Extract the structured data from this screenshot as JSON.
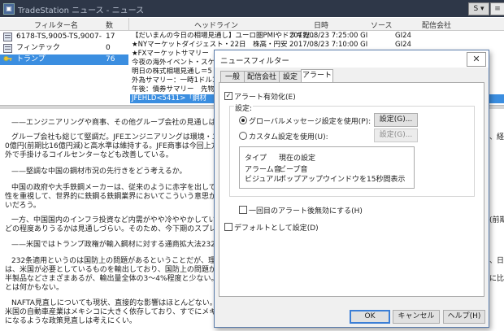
{
  "window": {
    "title": "TradeStation ニュース - ニュース",
    "s_menu": "S ▾",
    "win_btn": "≡"
  },
  "left": {
    "headers": {
      "filter": "フィルター名",
      "count": "数"
    },
    "rows": [
      {
        "name": "6178-TS,9005-TS,9007-",
        "count": "17"
      },
      {
        "name": "フィンテック",
        "count": "0"
      },
      {
        "name": "",
        "count": ""
      },
      {
        "name": "トランプ",
        "count": "76"
      }
    ]
  },
  "grid": {
    "headers": {
      "headline": "ヘッドライン",
      "date": "日時",
      "source": "ソース",
      "provider": "配信会社"
    },
    "rows": [
      {
        "headline": "【だいまんの今日の相場見通し】ユーロ圏PMIやドラギ総...",
        "date": "2017/08/23 7:25:00 GI",
        "source": "GI24"
      },
      {
        "headline": "★NYマーケットダイジェスト・22日　株高・円安",
        "date": "2017/08/23 7:10:00 GI",
        "source": "GI24"
      },
      {
        "headline": "★FXマーケットサマリー　ニュー",
        "date": "",
        "source": ""
      },
      {
        "headline": "今夜の海外イベント・スケジュ",
        "date": "",
        "source": ""
      },
      {
        "headline": "明日の株式相場見通し＝5",
        "date": "",
        "source": ""
      },
      {
        "headline": "外為サマリー：一時1ドル109",
        "date": "",
        "source": ""
      },
      {
        "headline": "午後：債券サマリー　先物は3",
        "date": "",
        "source": ""
      },
      {
        "headline": "JFEHLD<5411>「鋼材",
        "date": "",
        "source": ""
      }
    ]
  },
  "article": {
    "paragraphs": [
      "——エンジニアリングや商事、その他グループ会社の見通しはどう",
      "グループ会社も総じて堅調だ。JFEエンジニアリングは環境・エネル",
      "0億円(前期比16億円減)と高水準は維持する。JFE商事は今回上方",
      "外で手掛けるコイルセンターなども改善している。",
      "——堅調な中国の鋼材市況の先行きをどう考えるか。",
      "中国の政府や大手鉄鋼メーカーは、従来のように赤字を出してまで",
      "性を重視して、世界的に鉄鋼る鉄鋼業界においてこういう意思が感じ",
      "いだろう。",
      "一方、中国国内のインフラ投資など内需がやや冷ややかしているとは",
      "どの程度ありうるかは見通しづらい。そのため、今下期のスプレッド改善",
      "——米国ではトランプ政権が輸入鋼材に対する通商拡大法232条で",
      "232条適用というのは国防上の問題があるということだが、理解に苦",
      "は、米国が必要としているものを輸出しており、国防上の問題があるとは",
      "半製品などさまざまあるが、輸出量全体の3〜4%程度と少ない。ただ",
      "とは何かもない。",
      "NAFTA見直しについても現状、直接的な影響はほとんどない。メキ",
      "米国の自動車産業はメキシコに大きく依存しており、すでにメキシコ",
      "になるような政策見直しは考えにくい。"
    ],
    "right_fragments": [
      "、経常",
      "(前期",
      "、日本",
      "に比べ"
    ]
  },
  "dialog": {
    "title": "ニュースフィルター",
    "close": "✕",
    "tabs": [
      "一般",
      "配信会社",
      "設定",
      "アラート"
    ],
    "alert_enabled": "アラート有効化(E)",
    "settings_label": "設定:",
    "radio_global": "グローバルメッセージ設定を使用(P):",
    "radio_custom": "カスタム設定を使用(U):",
    "settings_btn_1": "設定(G)...",
    "settings_btn_2": "設定(G)...",
    "table": [
      {
        "k": "タイプ",
        "v": "現在の設定"
      },
      {
        "k": "アラーム音",
        "v": "ビープ音"
      },
      {
        "k": "ビジュアル",
        "v": "ポップアップウインドウを15秒間表示"
      }
    ],
    "once_alert": "一回目のアラート後無効にする(H)",
    "default_setting": "デフォルトとして設定(D)",
    "buttons": {
      "ok": "OK",
      "cancel": "キャンセル",
      "help": "ヘルプ(H)"
    }
  },
  "colors": {
    "selection": "#3b8ee0",
    "titlebar": "#2e3748",
    "dialog_border": "#5a7cab"
  }
}
